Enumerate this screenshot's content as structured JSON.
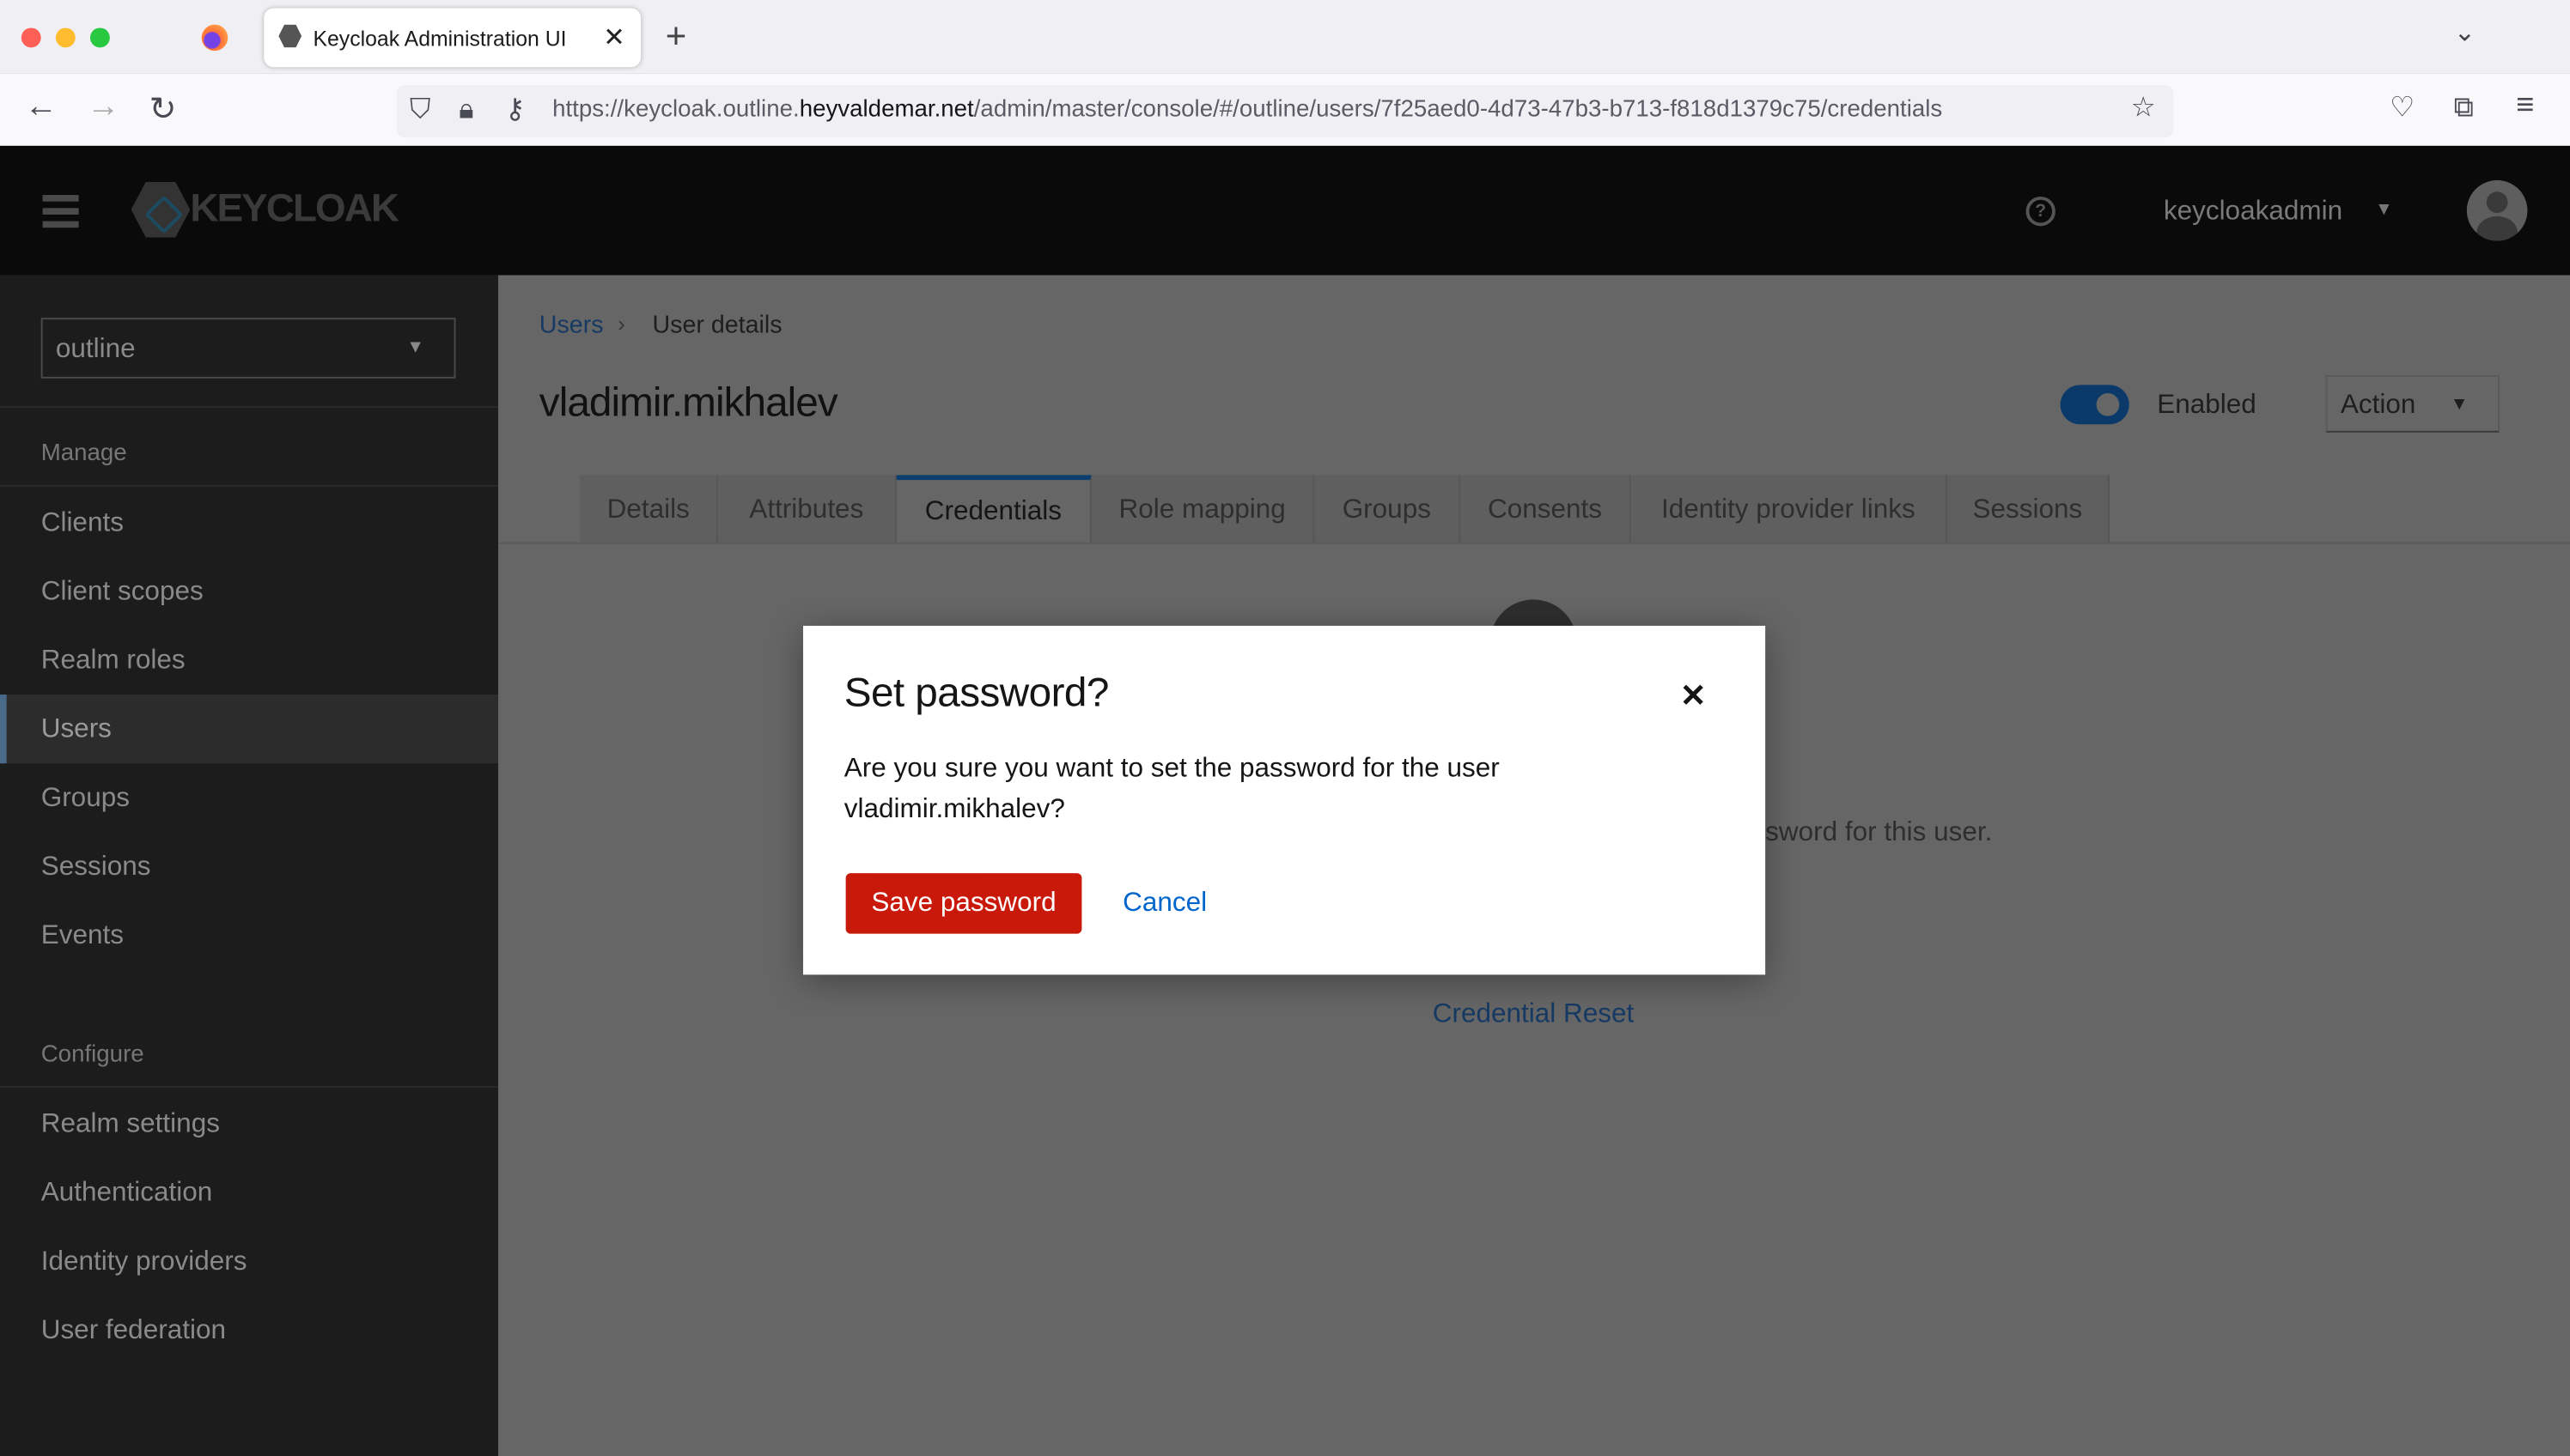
{
  "browser": {
    "tab_title": "Keycloak Administration UI",
    "url_prefix": "https://keycloak.outline.",
    "url_domain": "heyvaldemar.net",
    "url_suffix": "/admin/master/console/#/outline/users/7f25aed0-4d73-47b3-b713-f818d1379c75/credentials"
  },
  "header": {
    "logo_text": "KEYCLOAK",
    "username": "keycloakadmin"
  },
  "sidebar": {
    "realm": "outline",
    "manage_label": "Manage",
    "manage_items": [
      {
        "label": "Clients"
      },
      {
        "label": "Client scopes"
      },
      {
        "label": "Realm roles"
      },
      {
        "label": "Users",
        "active": true
      },
      {
        "label": "Groups"
      },
      {
        "label": "Sessions"
      },
      {
        "label": "Events"
      }
    ],
    "configure_label": "Configure",
    "configure_items": [
      {
        "label": "Realm settings"
      },
      {
        "label": "Authentication"
      },
      {
        "label": "Identity providers"
      },
      {
        "label": "User federation"
      }
    ]
  },
  "breadcrumb": {
    "link": "Users",
    "current": "User details"
  },
  "page": {
    "title": "vladimir.mikhalev",
    "enabled_label": "Enabled",
    "enabled": true,
    "action_label": "Action"
  },
  "tabs": [
    "Details",
    "Attributes",
    "Credentials",
    "Role mapping",
    "Groups",
    "Consents",
    "Identity provider links",
    "Sessions"
  ],
  "active_tab": "Credentials",
  "background": {
    "hint_fragment": "sword for this user.",
    "credential_reset": "Credential Reset"
  },
  "modal": {
    "title": "Set password?",
    "body_line1": "Are you sure you want to set the password for the user",
    "body_line2": "vladimir.mikhalev?",
    "confirm": "Save password",
    "cancel": "Cancel"
  },
  "colors": {
    "primary": "#c9190b",
    "link": "#0066cc",
    "header": "#151515"
  }
}
